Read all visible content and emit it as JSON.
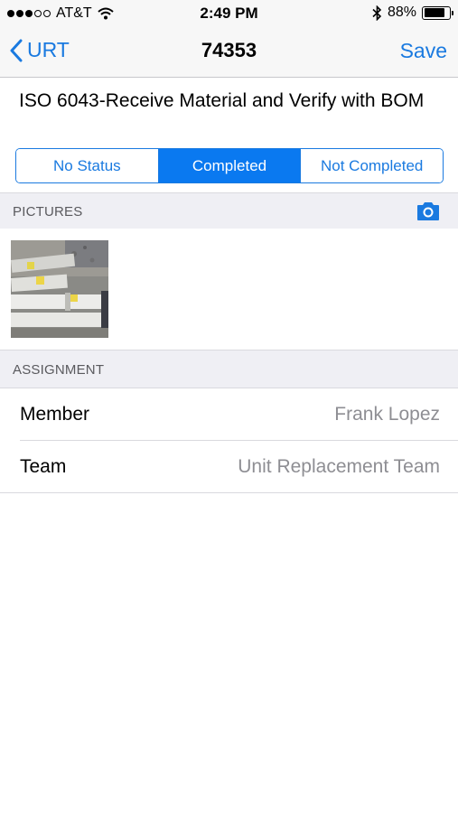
{
  "status_bar": {
    "carrier": "AT&T",
    "time": "2:49 PM",
    "battery": "88%",
    "battery_level": 0.88
  },
  "nav": {
    "back_label": "URT",
    "title": "74353",
    "save_label": "Save"
  },
  "task": {
    "title": "ISO 6043-Receive Material and Verify with BOM"
  },
  "status_segments": {
    "options": [
      "No Status",
      "Completed",
      "Not Completed"
    ],
    "selected": "Completed"
  },
  "pictures": {
    "header": "PICTURES",
    "camera_icon": "camera-icon"
  },
  "assignment": {
    "header": "ASSIGNMENT",
    "rows": [
      {
        "label": "Member",
        "value": "Frank Lopez"
      },
      {
        "label": "Team",
        "value": "Unit Replacement Team"
      }
    ]
  },
  "colors": {
    "accent": "#1a7ae0",
    "selected_segment": "#0a79f0",
    "section_bg": "#efeff4",
    "secondary_text": "#8e8e93"
  }
}
